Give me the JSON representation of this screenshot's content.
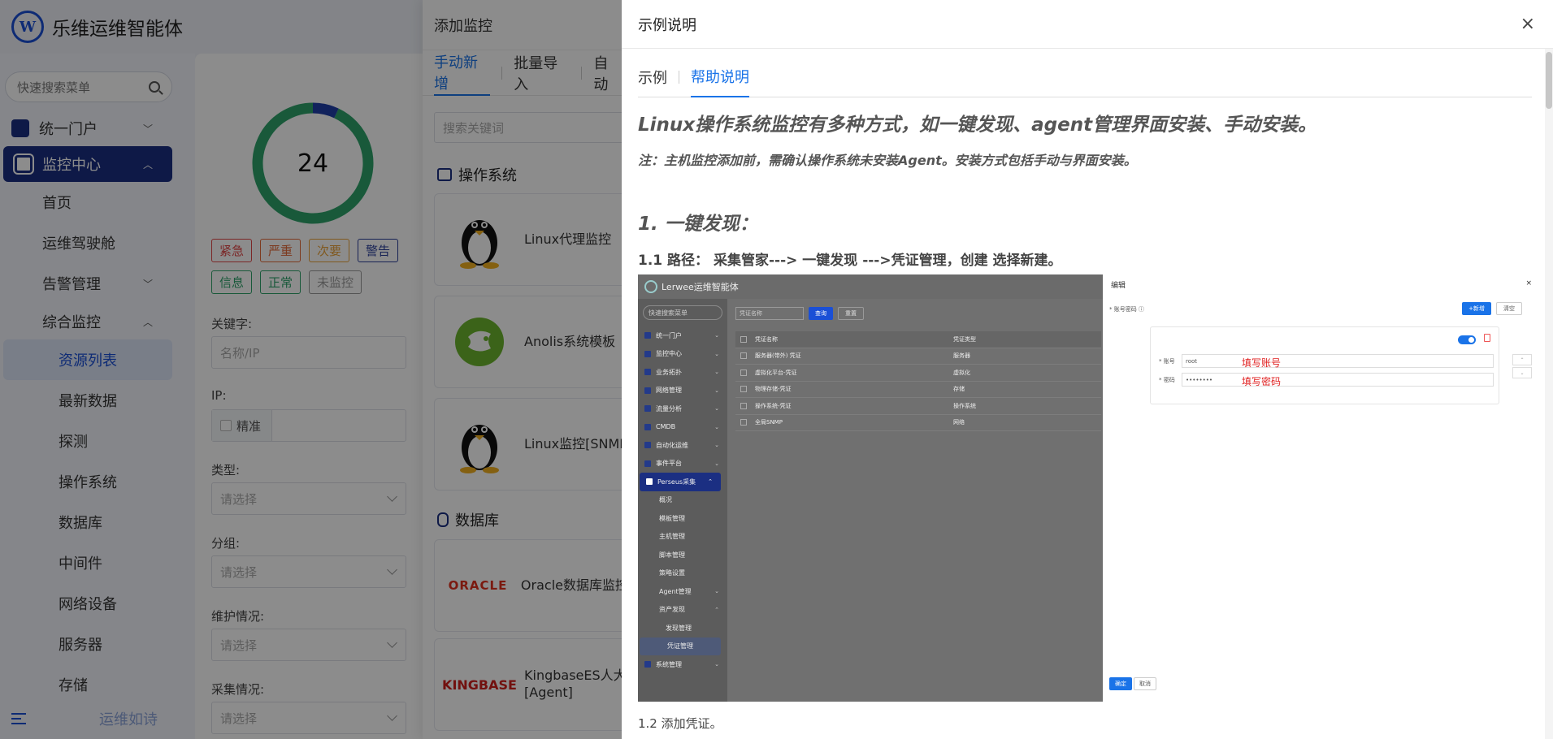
{
  "app": {
    "title": "乐维运维智能体",
    "logo_letter": "W"
  },
  "sidebar": {
    "search_placeholder": "快速搜索菜单",
    "groups": [
      {
        "label": "统一门户"
      },
      {
        "label": "监控中心"
      }
    ],
    "items": [
      {
        "label": "首页"
      },
      {
        "label": "运维驾驶舱"
      },
      {
        "label": "告警管理"
      },
      {
        "label": "综合监控"
      }
    ],
    "subitems": [
      {
        "label": "资源列表"
      },
      {
        "label": "最新数据"
      },
      {
        "label": "探测"
      },
      {
        "label": "操作系统"
      },
      {
        "label": "数据库"
      },
      {
        "label": "中间件"
      },
      {
        "label": "网络设备"
      },
      {
        "label": "服务器"
      },
      {
        "label": "存储"
      }
    ],
    "footer_text": "运维如诗"
  },
  "filter": {
    "donut": {
      "value": "24",
      "green_fraction": 0.93,
      "blue_fraction": 0.07,
      "colors": {
        "green": "#2fa36b",
        "blue": "#1f3fa8"
      }
    },
    "tags": [
      {
        "label": "紧急",
        "color": "#e04848"
      },
      {
        "label": "严重",
        "color": "#e46a3a"
      },
      {
        "label": "次要",
        "color": "#e9a23b"
      },
      {
        "label": "警告",
        "color": "#2a3f9c"
      },
      {
        "label": "信息",
        "color": "#2fa36b"
      },
      {
        "label": "正常",
        "color": "#2fa36b"
      },
      {
        "label": "未监控",
        "color": "#999999"
      }
    ],
    "keyword_label": "关键字:",
    "keyword_placeholder": "名称/IP",
    "ip_label": "IP:",
    "ip_exact_label": "精准",
    "type_label": "类型:",
    "type_placeholder": "请选择",
    "group_label": "分组:",
    "group_placeholder": "请选择",
    "maintain_label": "维护情况:",
    "maintain_placeholder": "请选择",
    "collect_label": "采集情况:",
    "collect_placeholder": "请选择"
  },
  "add_monitor": {
    "title": "添加监控",
    "tabs": [
      {
        "label": "手动新增"
      },
      {
        "label": "批量导入"
      },
      {
        "label": "自动"
      }
    ],
    "search_placeholder": "搜索关键词",
    "categories": [
      {
        "label": "操作系统"
      },
      {
        "label": "数据库"
      }
    ],
    "cards": [
      {
        "label": "Linux代理监控",
        "logo": "tux"
      },
      {
        "label": "Anolis系统模板",
        "logo": "anolis"
      },
      {
        "label": "Linux监控[SNMP",
        "logo": "tux"
      },
      {
        "label": "Oracle数据库监控",
        "logo": "ORACLE"
      },
      {
        "label": "KingbaseES人大",
        "label2": "[Agent]",
        "logo": "KINGBASE"
      }
    ]
  },
  "help": {
    "title": "示例说明",
    "close_label": "×",
    "tabs": [
      {
        "label": "示例"
      },
      {
        "label": "帮助说明"
      }
    ],
    "heading": "Linux操作系统监控有多种方式，如一键发现、agent管理界面安装、手动安装。",
    "note": "注：主机监控添加前，需确认操作系统未安装Agent。安装方式包括手动与界面安装。",
    "step1": "1. 一键发现：",
    "step1_path": "1.1  路径：  采集管家---> 一键发现 --->凭证管理，创建 选择新建。",
    "caption": "1.2 添加凭证。",
    "screenshot": {
      "app_title": "Lerwee运维智能体",
      "search": "快速搜索菜单",
      "menu": [
        {
          "label": "统一门户"
        },
        {
          "label": "监控中心"
        },
        {
          "label": "业务拓扑"
        },
        {
          "label": "网络管理"
        },
        {
          "label": "流量分析"
        },
        {
          "label": "CMDB"
        },
        {
          "label": "自动化运维"
        },
        {
          "label": "事件平台"
        }
      ],
      "active_menu": "Perseus采集",
      "submenu": [
        {
          "label": "概况"
        },
        {
          "label": "模板管理"
        },
        {
          "label": "主机管理"
        },
        {
          "label": "脚本管理"
        },
        {
          "label": "策略设置"
        },
        {
          "label": "Agent管理"
        },
        {
          "label": "资产发现"
        }
      ],
      "submenu3": [
        {
          "label": "发现管理"
        },
        {
          "label": "凭证管理"
        }
      ],
      "bottom_menu": "系统管理",
      "toolbar": {
        "input": "凭证名称",
        "query": "查询",
        "reset": "重置"
      },
      "table_head": {
        "c1": "凭证名称",
        "c2": "凭证类型"
      },
      "rows": [
        {
          "c1": "服务器(带外) 凭证",
          "c2": "服务器"
        },
        {
          "c1": "虚拟化平台-凭证",
          "c2": "虚拟化"
        },
        {
          "c1": "物理存储-凭证",
          "c2": "存储"
        },
        {
          "c1": "操作系统-凭证",
          "c2": "操作系统"
        },
        {
          "c1": "全局SNMP",
          "c2": "网络"
        }
      ],
      "dialog": {
        "title": "编辑",
        "close": "×",
        "field_label": "* 账号密码 ⓘ",
        "add_btn": "+新增",
        "clear_btn": "清空",
        "account_label": "* 账号",
        "account_value": "root",
        "account_note": "填写账号",
        "password_label": "* 密码",
        "password_value": "••••••••",
        "password_note": "填写密码",
        "ok": "确定",
        "cancel": "取消"
      }
    }
  }
}
